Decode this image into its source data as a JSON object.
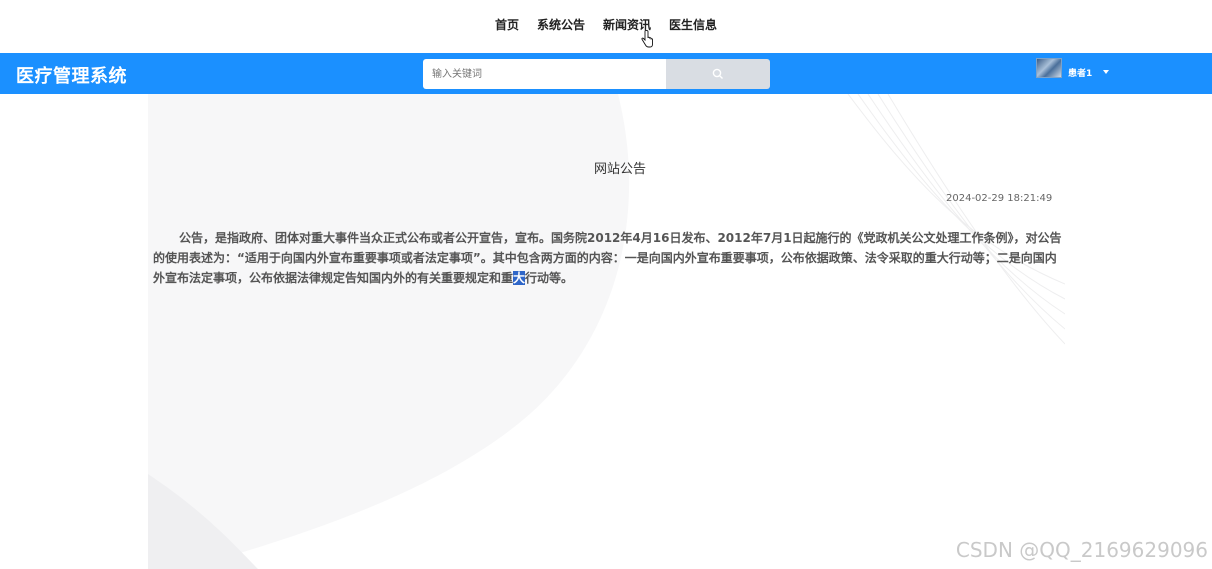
{
  "topnav": {
    "items": [
      {
        "label": "首页"
      },
      {
        "label": "系统公告"
      },
      {
        "label": "新闻资讯"
      },
      {
        "label": "医生信息"
      }
    ]
  },
  "header": {
    "logo": "医疗管理系统",
    "search": {
      "placeholder": "输入关键词",
      "value": ""
    },
    "user": {
      "name": "患者1",
      "icon": "avatar"
    },
    "accent_color": "#1b90ff"
  },
  "notice": {
    "title": "网站公告",
    "time": "2024-02-29 18:21:49",
    "body_before": "公告，是指政府、团体对重大事件当众正式公布或者公开宣告，宣布。国务院2012年4月16日发布、2012年7月1日起施行的《党政机关公文处理工作条例》，对公告的使用表述为：“适用于向国内外宣布重要事项或者法定事项”。其中包含两方面的内容：一是向国内外宣布重要事项，公布依据政策、法令采取的重大行动等；二是向国内外宣布法定事项，公布依据法律规定告知国内外的有关重要规定和重",
    "body_highlight": "大",
    "body_after": "行动等。"
  },
  "watermark": "CSDN @QQ_2169629096"
}
